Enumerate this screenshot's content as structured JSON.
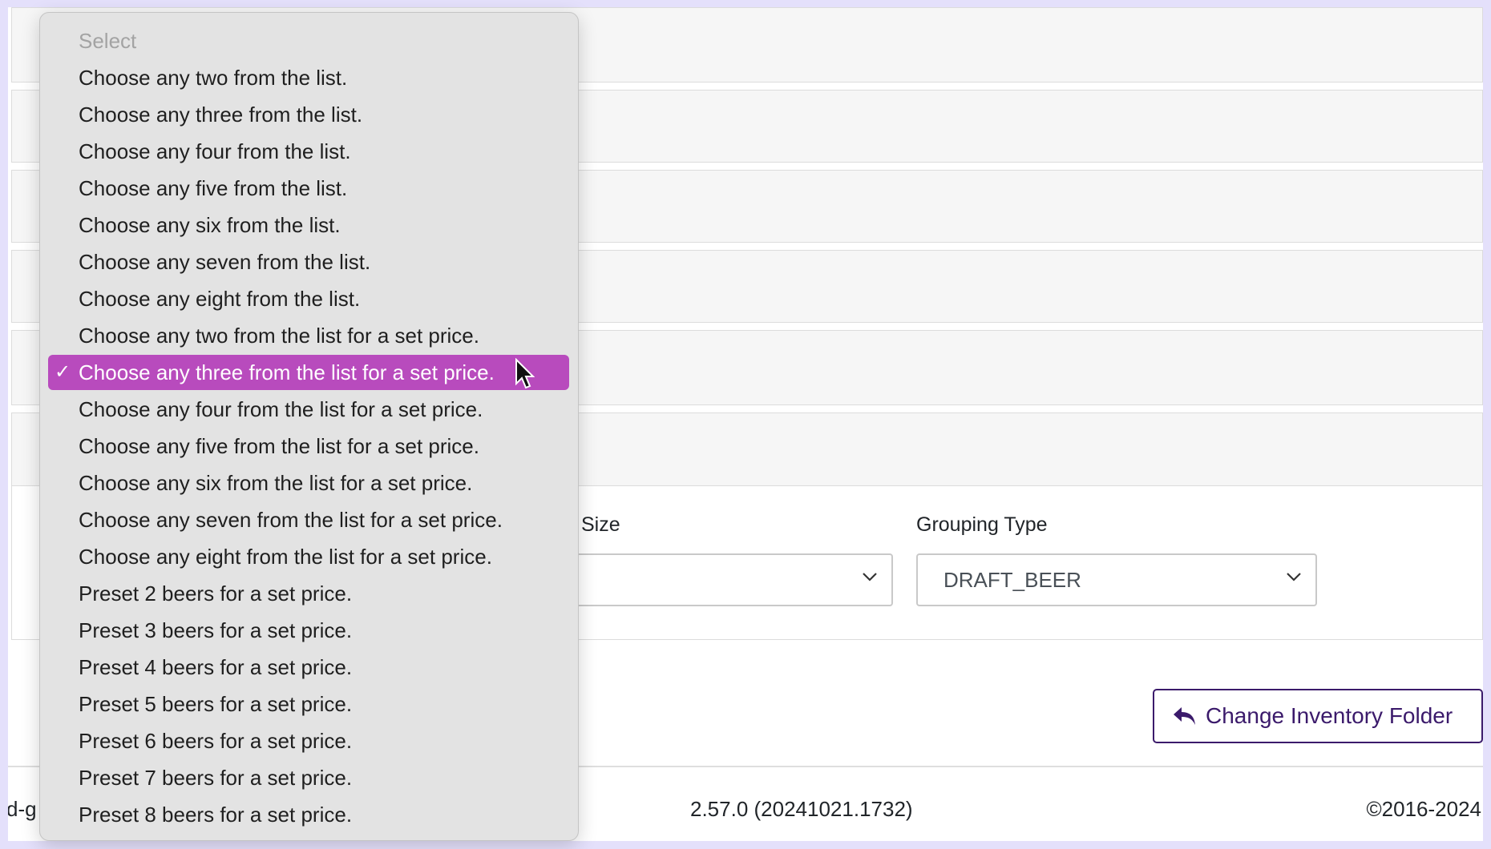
{
  "background_rows": [
    {
      "caret": "ˇ"
    },
    {
      "caret": "ˇ"
    },
    {
      "caret": "ˇ"
    },
    {
      "caret": "ˇ"
    },
    {
      "caret": "ˇ"
    },
    {
      "caret": "ˇ"
    }
  ],
  "form": {
    "size_label": "Size",
    "size_value": "",
    "grouping_label": "Grouping Type",
    "grouping_value": "DRAFT_BEER"
  },
  "actions": {
    "change_folder_label": "Change Inventory Folder",
    "change_folder_icon": "reply-icon"
  },
  "footer": {
    "left_fragment": "d-g",
    "version": "2.57.0 (20241021.1732)",
    "copyright": "©2016-2024"
  },
  "dropdown": {
    "selected_index": 9,
    "check_mark": "✓",
    "options": [
      "Select",
      "Choose any two from the list.",
      "Choose any three from the list.",
      "Choose any four from the list.",
      "Choose any five from the list.",
      "Choose any six from the list.",
      "Choose any seven from the list.",
      "Choose any eight from the list.",
      "Choose any two from the list for a set price.",
      "Choose any three from the list for a set price.",
      "Choose any four from the list for a set price.",
      "Choose any five from the list for a set price.",
      "Choose any six from the list for a set price.",
      "Choose any seven from the list for a set price.",
      "Choose any eight from the list for a set price.",
      "Preset 2 beers for a set price.",
      "Preset 3 beers for a set price.",
      "Preset 4 beers for a set price.",
      "Preset 5 beers for a set price.",
      "Preset 6 beers for a set price.",
      "Preset 7 beers for a set price.",
      "Preset 8 beers for a set price."
    ]
  },
  "colors": {
    "page_background": "#e4e0fb",
    "selected_highlight": "#b84bbd",
    "accent_purple": "#3b1a6b"
  }
}
